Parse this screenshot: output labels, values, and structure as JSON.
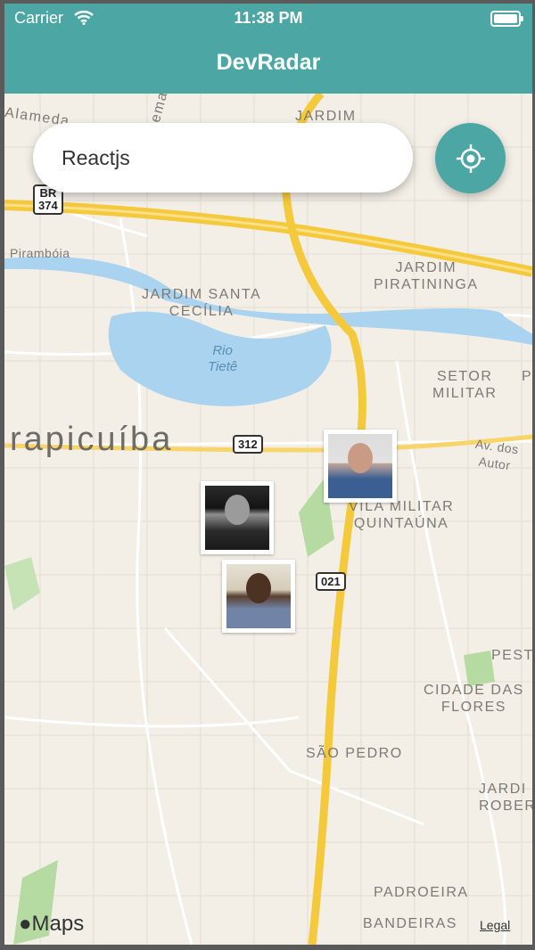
{
  "status_bar": {
    "carrier": "Carrier",
    "time": "11:38 PM"
  },
  "header": {
    "title": "DevRadar"
  },
  "search": {
    "value": "Reactjs"
  },
  "map": {
    "city": "rapicuíba",
    "lake": "Rio\nTietê",
    "road_labels": [
      "Alameda",
      "cema",
      "Pirambóia",
      "Av. dos Autor"
    ],
    "route_shields": [
      "BR\n374",
      "312",
      "021"
    ],
    "neighborhoods": [
      "JARDIM",
      "JARDIM\nPIRATININGA",
      "JARDIM SANTA\nCECÍLIA",
      "SETOR\nMILITAR",
      "P",
      "VILA MILITAR\nQUINTAÚNA",
      "PEST",
      "CIDADE DAS\nFLORES",
      "SÃO PEDRO",
      "JARDI\nROBERT",
      "PADROEIRA",
      "BANDEIRAS"
    ]
  },
  "attribution": {
    "logo": "Maps",
    "legal": "Legal"
  },
  "colors": {
    "primary": "#4ba6a4",
    "map_background": "#f3efe6",
    "water": "#a9d3ef",
    "highway": "#f5c93c",
    "park": "#b5dba3"
  },
  "icons": {
    "locate": "my-location-icon",
    "wifi": "wifi-icon",
    "battery": "battery-icon",
    "apple": "apple-icon"
  }
}
